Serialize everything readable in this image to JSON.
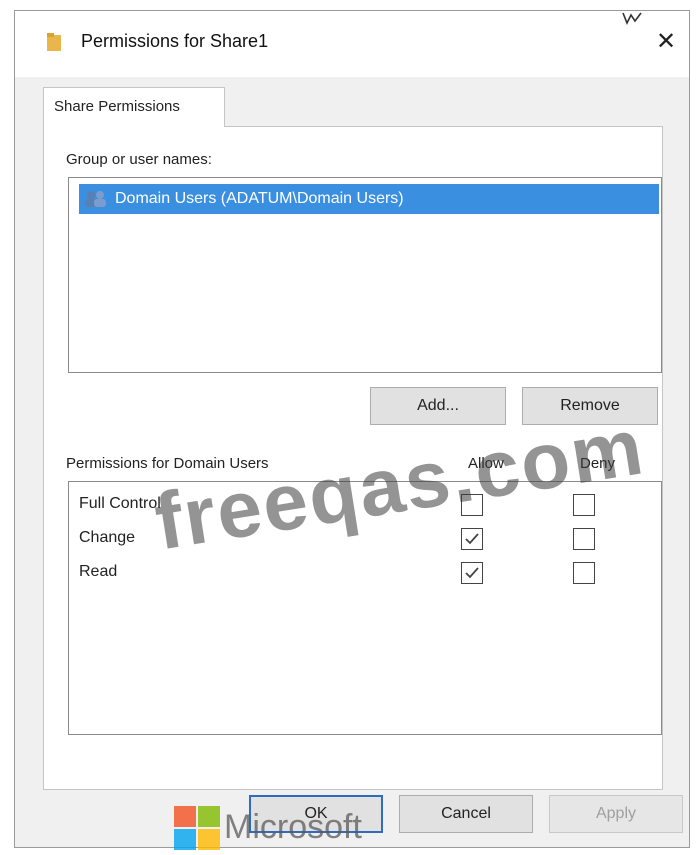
{
  "window": {
    "title": "Permissions for Share1",
    "close_glyph": "✕"
  },
  "tab": {
    "label": "Share Permissions"
  },
  "groups": {
    "label": "Group or user names:",
    "items": [
      {
        "name": "Domain Users (ADATUM\\Domain Users)",
        "selected": true,
        "icon": "users-icon"
      }
    ]
  },
  "buttons": {
    "add": "Add...",
    "remove": "Remove",
    "ok": "OK",
    "cancel": "Cancel",
    "apply": "Apply"
  },
  "permissions": {
    "label": "Permissions for Domain Users",
    "allow_header": "Allow",
    "deny_header": "Deny",
    "rows": [
      {
        "name": "Full Control",
        "allow": false,
        "deny": false
      },
      {
        "name": "Change",
        "allow": true,
        "deny": false
      },
      {
        "name": "Read",
        "allow": true,
        "deny": false
      }
    ]
  },
  "watermark": "freeqas.com",
  "brand": {
    "text": "Microsoft",
    "colors": [
      "#f25022",
      "#7fba00",
      "#00a4ef",
      "#ffb900"
    ]
  },
  "colors": {
    "selection": "#3a8fe0",
    "default_button_border": "#2f6cc0"
  }
}
